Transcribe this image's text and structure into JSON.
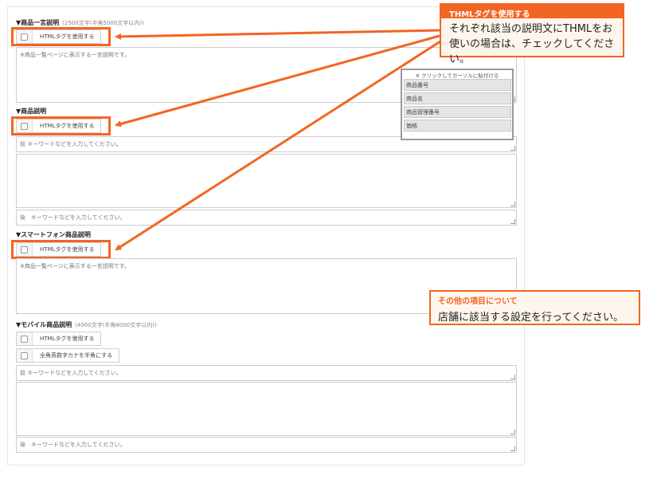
{
  "sections": {
    "oneline": {
      "title": "▼商品一言説明",
      "note": "(2500文字(半角5000文字以内))",
      "html_label": "HTMLタグを使用する",
      "text": "※商品一覧ページに表示する一言説明です。"
    },
    "desc": {
      "title": "▼商品説明",
      "html_label": "HTMLタグを使用する",
      "before_placeholder": "前 キーワードなどを入力してください。",
      "after_placeholder": "後　キーワードなどを入力してください。"
    },
    "smart": {
      "title": "▼スマートフォン商品説明",
      "html_label": "HTMLタグを使用する",
      "text": "※商品一覧ページに表示する一言説明です。"
    },
    "mobile": {
      "title": "▼モバイル商品説明",
      "note": "(4000文字(半角8000文字以内))",
      "html_label": "HTMLタグを使用する",
      "kana_label": "全角英数字カナを半角にする",
      "before_placeholder": "前 キーワードなどを入力してください。",
      "after_placeholder": "後　キーワードなどを入力してください。"
    }
  },
  "insert_panel": {
    "header": "※ クリックしてカーソルに貼付ける",
    "items": [
      "商品番号",
      "商品名",
      "商品管理番号",
      "価格"
    ]
  },
  "callout_html": {
    "title": "THMLタグを使用する",
    "line1": "それぞれ該当の説明文にTHMLをお",
    "line2": "使いの場合は、チェックしてください。"
  },
  "callout_other": {
    "title": "その他の項目について",
    "text": "店舗に該当する設定を行ってください。"
  },
  "colors": {
    "accent": "#f26522",
    "callout_bg": "#fef6ec"
  }
}
